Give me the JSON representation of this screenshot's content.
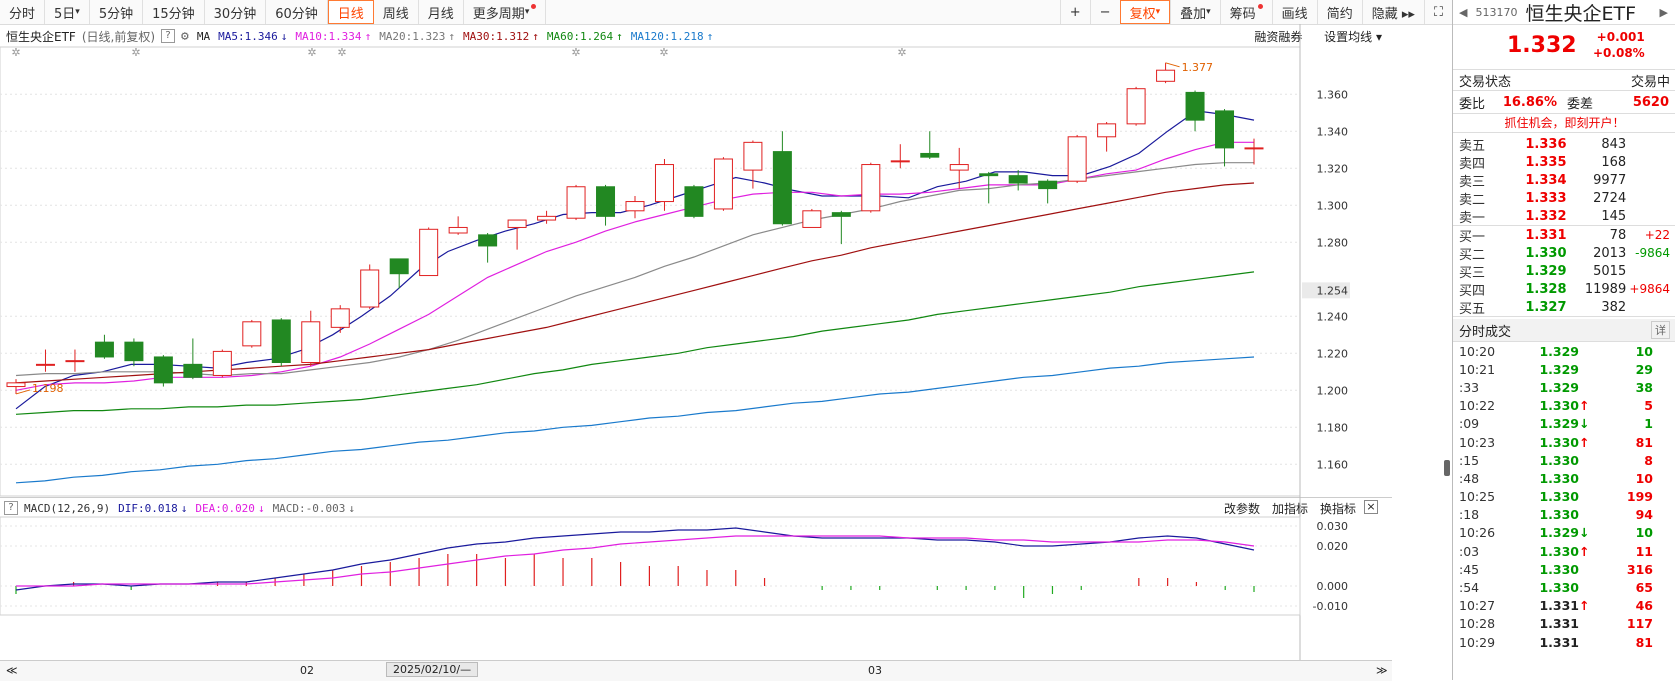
{
  "toolbar": {
    "left": [
      {
        "label": "分时"
      },
      {
        "label": "5日",
        "drop": true
      },
      {
        "label": "5分钟"
      },
      {
        "label": "15分钟"
      },
      {
        "label": "30分钟"
      },
      {
        "label": "60分钟"
      },
      {
        "label": "日线",
        "active": true
      },
      {
        "label": "周线"
      },
      {
        "label": "月线"
      },
      {
        "label": "更多周期",
        "drop": true,
        "dot": true
      }
    ],
    "right": [
      {
        "label": "+"
      },
      {
        "label": "−"
      },
      {
        "label": "复权",
        "active": true,
        "drop": true
      },
      {
        "label": "叠加",
        "drop": true
      },
      {
        "label": "筹码",
        "dot": true
      },
      {
        "label": "画线"
      },
      {
        "label": "简约"
      },
      {
        "label": "隐藏 ▸▸"
      },
      {
        "label": "⛶"
      }
    ]
  },
  "info": {
    "name": "恒生央企ETF",
    "sub": "(日线,前复权)",
    "help": "?",
    "ma_label": "MA",
    "ma": [
      {
        "text": "MA5:1.346",
        "arrow": "↓",
        "color": "#1a1a9c"
      },
      {
        "text": "MA10:1.334",
        "arrow": "↑",
        "color": "#e020e0"
      },
      {
        "text": "MA20:1.323",
        "arrow": "↑",
        "color": "#777777"
      },
      {
        "text": "MA30:1.312",
        "arrow": "↑",
        "color": "#a01010"
      },
      {
        "text": "MA60:1.264",
        "arrow": "↑",
        "color": "#118811"
      },
      {
        "text": "MA120:1.218",
        "arrow": "↑",
        "color": "#1a7acc"
      }
    ],
    "links": [
      "融资融券",
      "设置均线 ▾"
    ]
  },
  "macd": {
    "help": "?",
    "label": "MACD(12,26,9)",
    "dif": "DIF:0.018",
    "dif_arrow": "↓",
    "dea": "DEA:0.020",
    "dea_arrow": "↓",
    "macd": "MACD:-0.003",
    "macd_arrow": "↓",
    "links": [
      "改参数",
      "加指标",
      "换指标"
    ],
    "close": "×"
  },
  "datebar": {
    "left": "≪",
    "m1": "02",
    "cursor": "2025/02/10/—",
    "m2": "03",
    "right": "≫"
  },
  "chart_data": {
    "type": "candlestick",
    "ylim": [
      1.145,
      1.385
    ],
    "yticks": [
      1.16,
      1.18,
      1.2,
      1.22,
      1.24,
      1.254,
      1.28,
      1.3,
      1.32,
      1.34,
      1.36
    ],
    "highlight_tick": 1.254,
    "max_label": "1.377",
    "min_label": "1.198",
    "candles": [
      {
        "o": 1.202,
        "c": 1.204,
        "h": 1.206,
        "l": 1.198
      },
      {
        "o": 1.214,
        "c": 1.214,
        "h": 1.222,
        "l": 1.21
      },
      {
        "o": 1.216,
        "c": 1.216,
        "h": 1.222,
        "l": 1.21
      },
      {
        "o": 1.226,
        "c": 1.218,
        "h": 1.23,
        "l": 1.217
      },
      {
        "o": 1.226,
        "c": 1.216,
        "h": 1.228,
        "l": 1.213
      },
      {
        "o": 1.218,
        "c": 1.204,
        "h": 1.219,
        "l": 1.202
      },
      {
        "o": 1.214,
        "c": 1.207,
        "h": 1.228,
        "l": 1.206
      },
      {
        "o": 1.208,
        "c": 1.221,
        "h": 1.222,
        "l": 1.207
      },
      {
        "o": 1.224,
        "c": 1.237,
        "h": 1.238,
        "l": 1.223
      },
      {
        "o": 1.238,
        "c": 1.215,
        "h": 1.239,
        "l": 1.213
      },
      {
        "o": 1.215,
        "c": 1.237,
        "h": 1.243,
        "l": 1.213
      },
      {
        "o": 1.234,
        "c": 1.244,
        "h": 1.246,
        "l": 1.231
      },
      {
        "o": 1.245,
        "c": 1.265,
        "h": 1.268,
        "l": 1.244
      },
      {
        "o": 1.271,
        "c": 1.263,
        "h": 1.271,
        "l": 1.255
      },
      {
        "o": 1.262,
        "c": 1.287,
        "h": 1.288,
        "l": 1.262
      },
      {
        "o": 1.285,
        "c": 1.288,
        "h": 1.294,
        "l": 1.284
      },
      {
        "o": 1.284,
        "c": 1.278,
        "h": 1.285,
        "l": 1.269
      },
      {
        "o": 1.288,
        "c": 1.292,
        "h": 1.292,
        "l": 1.276
      },
      {
        "o": 1.292,
        "c": 1.294,
        "h": 1.297,
        "l": 1.29
      },
      {
        "o": 1.293,
        "c": 1.31,
        "h": 1.311,
        "l": 1.292
      },
      {
        "o": 1.31,
        "c": 1.294,
        "h": 1.311,
        "l": 1.289
      },
      {
        "o": 1.297,
        "c": 1.302,
        "h": 1.305,
        "l": 1.293
      },
      {
        "o": 1.302,
        "c": 1.322,
        "h": 1.325,
        "l": 1.297
      },
      {
        "o": 1.31,
        "c": 1.294,
        "h": 1.311,
        "l": 1.293
      },
      {
        "o": 1.298,
        "c": 1.325,
        "h": 1.326,
        "l": 1.297
      },
      {
        "o": 1.319,
        "c": 1.334,
        "h": 1.335,
        "l": 1.309
      },
      {
        "o": 1.329,
        "c": 1.29,
        "h": 1.34,
        "l": 1.289
      },
      {
        "o": 1.288,
        "c": 1.297,
        "h": 1.298,
        "l": 1.288
      },
      {
        "o": 1.296,
        "c": 1.294,
        "h": 1.297,
        "l": 1.279
      },
      {
        "o": 1.297,
        "c": 1.322,
        "h": 1.323,
        "l": 1.296
      },
      {
        "o": 1.324,
        "c": 1.324,
        "h": 1.333,
        "l": 1.32
      },
      {
        "o": 1.328,
        "c": 1.326,
        "h": 1.34,
        "l": 1.325
      },
      {
        "o": 1.319,
        "c": 1.322,
        "h": 1.331,
        "l": 1.309
      },
      {
        "o": 1.317,
        "c": 1.316,
        "h": 1.318,
        "l": 1.301
      },
      {
        "o": 1.316,
        "c": 1.312,
        "h": 1.319,
        "l": 1.308
      },
      {
        "o": 1.313,
        "c": 1.309,
        "h": 1.314,
        "l": 1.301
      },
      {
        "o": 1.313,
        "c": 1.337,
        "h": 1.338,
        "l": 1.312
      },
      {
        "o": 1.337,
        "c": 1.344,
        "h": 1.345,
        "l": 1.329
      },
      {
        "o": 1.344,
        "c": 1.363,
        "h": 1.364,
        "l": 1.343
      },
      {
        "o": 1.367,
        "c": 1.373,
        "h": 1.377,
        "l": 1.366
      },
      {
        "o": 1.361,
        "c": 1.346,
        "h": 1.362,
        "l": 1.34
      },
      {
        "o": 1.351,
        "c": 1.331,
        "h": 1.352,
        "l": 1.321
      },
      {
        "o": 1.331,
        "c": 1.331,
        "h": 1.336,
        "l": 1.322
      }
    ],
    "ma": {
      "MA5": [
        1.19,
        1.202,
        1.208,
        1.21,
        1.214,
        1.214,
        1.213,
        1.212,
        1.215,
        1.217,
        1.222,
        1.23,
        1.24,
        1.251,
        1.265,
        1.275,
        1.281,
        1.286,
        1.29,
        1.295,
        1.296,
        1.296,
        1.3,
        1.305,
        1.31,
        1.315,
        1.312,
        1.308,
        1.305,
        1.305,
        1.305,
        1.304,
        1.31,
        1.313,
        1.318,
        1.318,
        1.316,
        1.316,
        1.321,
        1.328,
        1.34,
        1.351,
        1.349,
        1.346
      ],
      "MA10": [
        1.2,
        1.203,
        1.204,
        1.204,
        1.205,
        1.207,
        1.207,
        1.207,
        1.208,
        1.21,
        1.213,
        1.218,
        1.225,
        1.233,
        1.241,
        1.251,
        1.261,
        1.268,
        1.275,
        1.28,
        1.286,
        1.291,
        1.295,
        1.299,
        1.303,
        1.306,
        1.307,
        1.307,
        1.305,
        1.306,
        1.306,
        1.307,
        1.309,
        1.311,
        1.311,
        1.311,
        1.314,
        1.317,
        1.319,
        1.325,
        1.33,
        1.334,
        1.334
      ],
      "MA20": [
        1.208,
        1.209,
        1.209,
        1.21,
        1.21,
        1.21,
        1.209,
        1.208,
        1.209,
        1.209,
        1.211,
        1.213,
        1.215,
        1.218,
        1.222,
        1.227,
        1.233,
        1.239,
        1.245,
        1.251,
        1.256,
        1.261,
        1.267,
        1.272,
        1.278,
        1.284,
        1.288,
        1.292,
        1.295,
        1.298,
        1.302,
        1.305,
        1.308,
        1.309,
        1.311,
        1.312,
        1.314,
        1.316,
        1.318,
        1.32,
        1.322,
        1.323,
        1.323
      ],
      "MA30": [
        1.204,
        1.205,
        1.206,
        1.207,
        1.208,
        1.209,
        1.21,
        1.211,
        1.212,
        1.213,
        1.214,
        1.216,
        1.218,
        1.22,
        1.222,
        1.225,
        1.228,
        1.231,
        1.234,
        1.238,
        1.242,
        1.246,
        1.25,
        1.254,
        1.258,
        1.262,
        1.266,
        1.27,
        1.273,
        1.277,
        1.28,
        1.283,
        1.286,
        1.289,
        1.292,
        1.295,
        1.298,
        1.301,
        1.304,
        1.307,
        1.309,
        1.311,
        1.312
      ],
      "MA60": [
        1.187,
        1.188,
        1.189,
        1.189,
        1.19,
        1.19,
        1.191,
        1.191,
        1.192,
        1.192,
        1.193,
        1.194,
        1.195,
        1.197,
        1.199,
        1.201,
        1.203,
        1.206,
        1.209,
        1.211,
        1.214,
        1.216,
        1.218,
        1.22,
        1.223,
        1.225,
        1.227,
        1.229,
        1.232,
        1.234,
        1.236,
        1.238,
        1.241,
        1.243,
        1.245,
        1.247,
        1.249,
        1.251,
        1.253,
        1.256,
        1.258,
        1.26,
        1.262,
        1.264
      ],
      "MA120": [
        1.15,
        1.151,
        1.153,
        1.154,
        1.156,
        1.157,
        1.159,
        1.16,
        1.162,
        1.163,
        1.165,
        1.167,
        1.168,
        1.17,
        1.172,
        1.173,
        1.175,
        1.177,
        1.178,
        1.18,
        1.181,
        1.183,
        1.185,
        1.186,
        1.188,
        1.189,
        1.191,
        1.193,
        1.194,
        1.196,
        1.198,
        1.199,
        1.201,
        1.203,
        1.205,
        1.207,
        1.208,
        1.21,
        1.212,
        1.213,
        1.215,
        1.216,
        1.217,
        1.218
      ]
    },
    "macd": {
      "ylim": [
        -0.014,
        0.034
      ],
      "yticks": [
        0.03,
        0.02,
        0.0,
        -0.01
      ],
      "dif": [
        -0.002,
        0.0,
        0.001,
        0.001,
        0.0,
        0.001,
        0.001,
        0.002,
        0.002,
        0.004,
        0.006,
        0.008,
        0.011,
        0.013,
        0.016,
        0.019,
        0.021,
        0.022,
        0.024,
        0.025,
        0.026,
        0.027,
        0.027,
        0.028,
        0.028,
        0.029,
        0.027,
        0.025,
        0.024,
        0.024,
        0.024,
        0.024,
        0.023,
        0.023,
        0.022,
        0.02,
        0.02,
        0.021,
        0.022,
        0.024,
        0.025,
        0.024,
        0.021,
        0.018
      ],
      "dea": [
        0.0,
        0.0,
        0.0,
        0.001,
        0.001,
        0.001,
        0.001,
        0.001,
        0.001,
        0.002,
        0.003,
        0.004,
        0.006,
        0.007,
        0.009,
        0.011,
        0.013,
        0.015,
        0.016,
        0.018,
        0.019,
        0.021,
        0.022,
        0.023,
        0.024,
        0.025,
        0.025,
        0.025,
        0.025,
        0.025,
        0.025,
        0.024,
        0.024,
        0.024,
        0.023,
        0.023,
        0.022,
        0.022,
        0.022,
        0.022,
        0.023,
        0.023,
        0.022,
        0.02
      ],
      "hist": [
        -0.004,
        0.0,
        0.002,
        0.0,
        -0.002,
        0.0,
        0.0,
        0.002,
        0.002,
        0.004,
        0.006,
        0.008,
        0.01,
        0.012,
        0.014,
        0.016,
        0.016,
        0.014,
        0.016,
        0.014,
        0.014,
        0.012,
        0.01,
        0.01,
        0.008,
        0.008,
        0.004,
        0.0,
        -0.002,
        -0.002,
        -0.002,
        0.0,
        -0.002,
        -0.002,
        -0.002,
        -0.006,
        -0.004,
        -0.002,
        0.0,
        0.004,
        0.004,
        0.002,
        -0.002,
        -0.003
      ]
    }
  },
  "panel": {
    "code": "513170",
    "name": "恒生央企ETF",
    "price": "1.332",
    "change": "+0.001",
    "pct": "+0.08%",
    "status_label": "交易状态",
    "status_value": "交易中",
    "weibi_label": "委比",
    "weibi": "16.86%",
    "weicha_label": "委差",
    "weicha": "5620",
    "promo": "抓住机会，即刻开户！",
    "asks": [
      {
        "l": "卖五",
        "p": "1.336",
        "v": "843",
        "d": ""
      },
      {
        "l": "卖四",
        "p": "1.335",
        "v": "168",
        "d": ""
      },
      {
        "l": "卖三",
        "p": "1.334",
        "v": "9977",
        "d": ""
      },
      {
        "l": "卖二",
        "p": "1.333",
        "v": "2724",
        "d": ""
      },
      {
        "l": "卖一",
        "p": "1.332",
        "v": "145",
        "d": ""
      }
    ],
    "bids": [
      {
        "l": "买一",
        "p": "1.331",
        "v": "78",
        "d": "+22"
      },
      {
        "l": "买二",
        "p": "1.330",
        "v": "2013",
        "d": "-9864"
      },
      {
        "l": "买三",
        "p": "1.329",
        "v": "5015",
        "d": ""
      },
      {
        "l": "买四",
        "p": "1.328",
        "v": "11989",
        "d": "+9864"
      },
      {
        "l": "买五",
        "p": "1.327",
        "v": "382",
        "d": ""
      }
    ],
    "ticks_title": "分时成交",
    "ticks_btn": "详",
    "ticks": [
      {
        "t": "10:20",
        "p": "1.329",
        "a": "",
        "v": "10",
        "pc": "green",
        "vc": "green"
      },
      {
        "t": "10:21",
        "p": "1.329",
        "a": "",
        "v": "29",
        "pc": "green",
        "vc": "green"
      },
      {
        "t": ":33",
        "p": "1.329",
        "a": "",
        "v": "38",
        "pc": "green",
        "vc": "green"
      },
      {
        "t": "10:22",
        "p": "1.330",
        "a": "↑",
        "v": "5",
        "pc": "green",
        "vc": "red"
      },
      {
        "t": ":09",
        "p": "1.329",
        "a": "↓",
        "v": "1",
        "pc": "green",
        "vc": "green"
      },
      {
        "t": "10:23",
        "p": "1.330",
        "a": "↑",
        "v": "81",
        "pc": "green",
        "vc": "red"
      },
      {
        "t": ":15",
        "p": "1.330",
        "a": "",
        "v": "8",
        "pc": "green",
        "vc": "red"
      },
      {
        "t": ":48",
        "p": "1.330",
        "a": "",
        "v": "10",
        "pc": "green",
        "vc": "red"
      },
      {
        "t": "10:25",
        "p": "1.330",
        "a": "",
        "v": "199",
        "pc": "green",
        "vc": "red"
      },
      {
        "t": ":18",
        "p": "1.330",
        "a": "",
        "v": "94",
        "pc": "green",
        "vc": "red"
      },
      {
        "t": "10:26",
        "p": "1.329",
        "a": "↓",
        "v": "10",
        "pc": "green",
        "vc": "green"
      },
      {
        "t": ":03",
        "p": "1.330",
        "a": "↑",
        "v": "11",
        "pc": "green",
        "vc": "red"
      },
      {
        "t": ":45",
        "p": "1.330",
        "a": "",
        "v": "316",
        "pc": "green",
        "vc": "red"
      },
      {
        "t": ":54",
        "p": "1.330",
        "a": "",
        "v": "65",
        "pc": "green",
        "vc": "red"
      },
      {
        "t": "10:27",
        "p": "1.331",
        "a": "↑",
        "v": "46",
        "pc": "blk",
        "vc": "red"
      },
      {
        "t": "10:28",
        "p": "1.331",
        "a": "",
        "v": "117",
        "pc": "blk",
        "vc": "red"
      },
      {
        "t": "10:29",
        "p": "1.331",
        "a": "",
        "v": "81",
        "pc": "blk",
        "vc": "red"
      }
    ]
  }
}
